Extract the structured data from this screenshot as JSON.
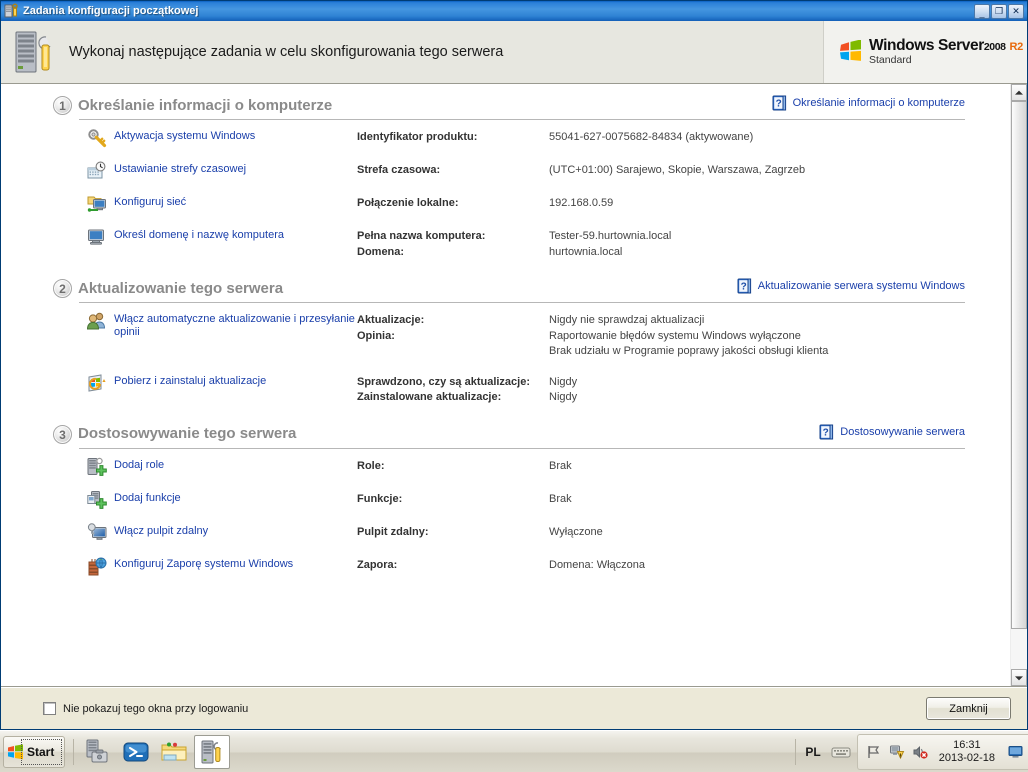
{
  "window": {
    "title": "Zadania konfiguracji początkowej",
    "icon": "server-tasks-icon",
    "buttons": {
      "minimize": "_",
      "maximize": "❐",
      "close": "✕"
    }
  },
  "header": {
    "icon": "server-wrench-icon",
    "heading": "Wykonaj następujące zadania w celu skonfigurowania tego serwera",
    "brand": {
      "product": "Windows Server",
      "year": "2008",
      "release": "R2",
      "edition": "Standard"
    }
  },
  "sections": [
    {
      "number": "1",
      "title": "Określanie informacji o komputerze",
      "help_label": "Określanie informacji o komputerze",
      "rows": [
        {
          "task_icon": "key-activate-icon",
          "task": "Aktywacja systemu Windows",
          "labels": [
            "Identyfikator produktu:"
          ],
          "values": [
            "55041-627-0075682-84834 (aktywowane)"
          ]
        },
        {
          "task_icon": "clock-timezone-icon",
          "task": "Ustawianie strefy czasowej",
          "labels": [
            "Strefa czasowa:"
          ],
          "values": [
            "(UTC+01:00) Sarajewo, Skopie, Warszawa, Zagrzeb"
          ]
        },
        {
          "task_icon": "network-folder-icon",
          "task": "Konfiguruj sieć",
          "labels": [
            "Połączenie lokalne:"
          ],
          "values": [
            "192.168.0.59"
          ]
        },
        {
          "task_icon": "computer-domain-icon",
          "task": "Określ domenę i nazwę komputera",
          "labels": [
            "Pełna nazwa komputera:",
            "Domena:"
          ],
          "values": [
            "Tester-59.hurtownia.local",
            "hurtownia.local"
          ]
        }
      ]
    },
    {
      "number": "2",
      "title": "Aktualizowanie tego serwera",
      "help_label": "Aktualizowanie serwera systemu Windows",
      "rows": [
        {
          "task_icon": "users-feedback-icon",
          "task": "Włącz automatyczne aktualizowanie i przesyłanie opinii",
          "labels": [
            "Aktualizacje:",
            "Opinia:"
          ],
          "values": [
            "Nigdy nie sprawdzaj aktualizacji",
            "Raportowanie błędów systemu Windows wyłączone",
            "Brak udziału w Programie poprawy jakości obsługi klienta"
          ]
        },
        {
          "task_icon": "windows-update-icon",
          "task": "Pobierz i zainstaluj aktualizacje",
          "labels": [
            "Sprawdzono, czy są aktualizacje:",
            "Zainstalowane aktualizacje:"
          ],
          "values": [
            "Nigdy",
            "Nigdy"
          ]
        }
      ]
    },
    {
      "number": "3",
      "title": "Dostosowywanie tego serwera",
      "help_label": "Dostosowywanie serwera",
      "rows": [
        {
          "task_icon": "add-roles-icon",
          "task": "Dodaj role",
          "labels": [
            "Role:"
          ],
          "values": [
            "Brak"
          ]
        },
        {
          "task_icon": "add-features-icon",
          "task": "Dodaj funkcje",
          "labels": [
            "Funkcje:"
          ],
          "values": [
            "Brak"
          ]
        },
        {
          "task_icon": "remote-desktop-icon",
          "task": "Włącz pulpit zdalny",
          "labels": [
            "Pulpit zdalny:"
          ],
          "values": [
            "Wyłączone"
          ]
        },
        {
          "task_icon": "firewall-icon",
          "task": "Konfiguruj Zaporę systemu Windows",
          "labels": [
            "Zapora:"
          ],
          "values": [
            "Domena: Włączona"
          ]
        }
      ]
    }
  ],
  "footer": {
    "checkbox_label": "Nie pokazuj tego okna przy logowaniu",
    "checkbox_checked": false,
    "close_button": "Zamknij"
  },
  "taskbar": {
    "start_label": "Start",
    "items": [
      {
        "name": "server-manager-icon"
      },
      {
        "name": "powershell-icon"
      },
      {
        "name": "explorer-icon"
      },
      {
        "name": "initial-config-tasks-icon",
        "active": true
      }
    ],
    "tray": {
      "language": "PL",
      "keyboard_icon": "keyboard-icon",
      "icons": [
        "flag-action-center-icon",
        "network-warning-icon",
        "volume-muted-icon"
      ],
      "time": "16:31",
      "date": "2013-02-18",
      "show-desktop": "show-desktop-icon"
    }
  },
  "colors": {
    "link": "#1a3faa",
    "section_title": "#8a8a8a",
    "title_bar": "#2f83d4",
    "brand_r2": "#e8690b"
  }
}
